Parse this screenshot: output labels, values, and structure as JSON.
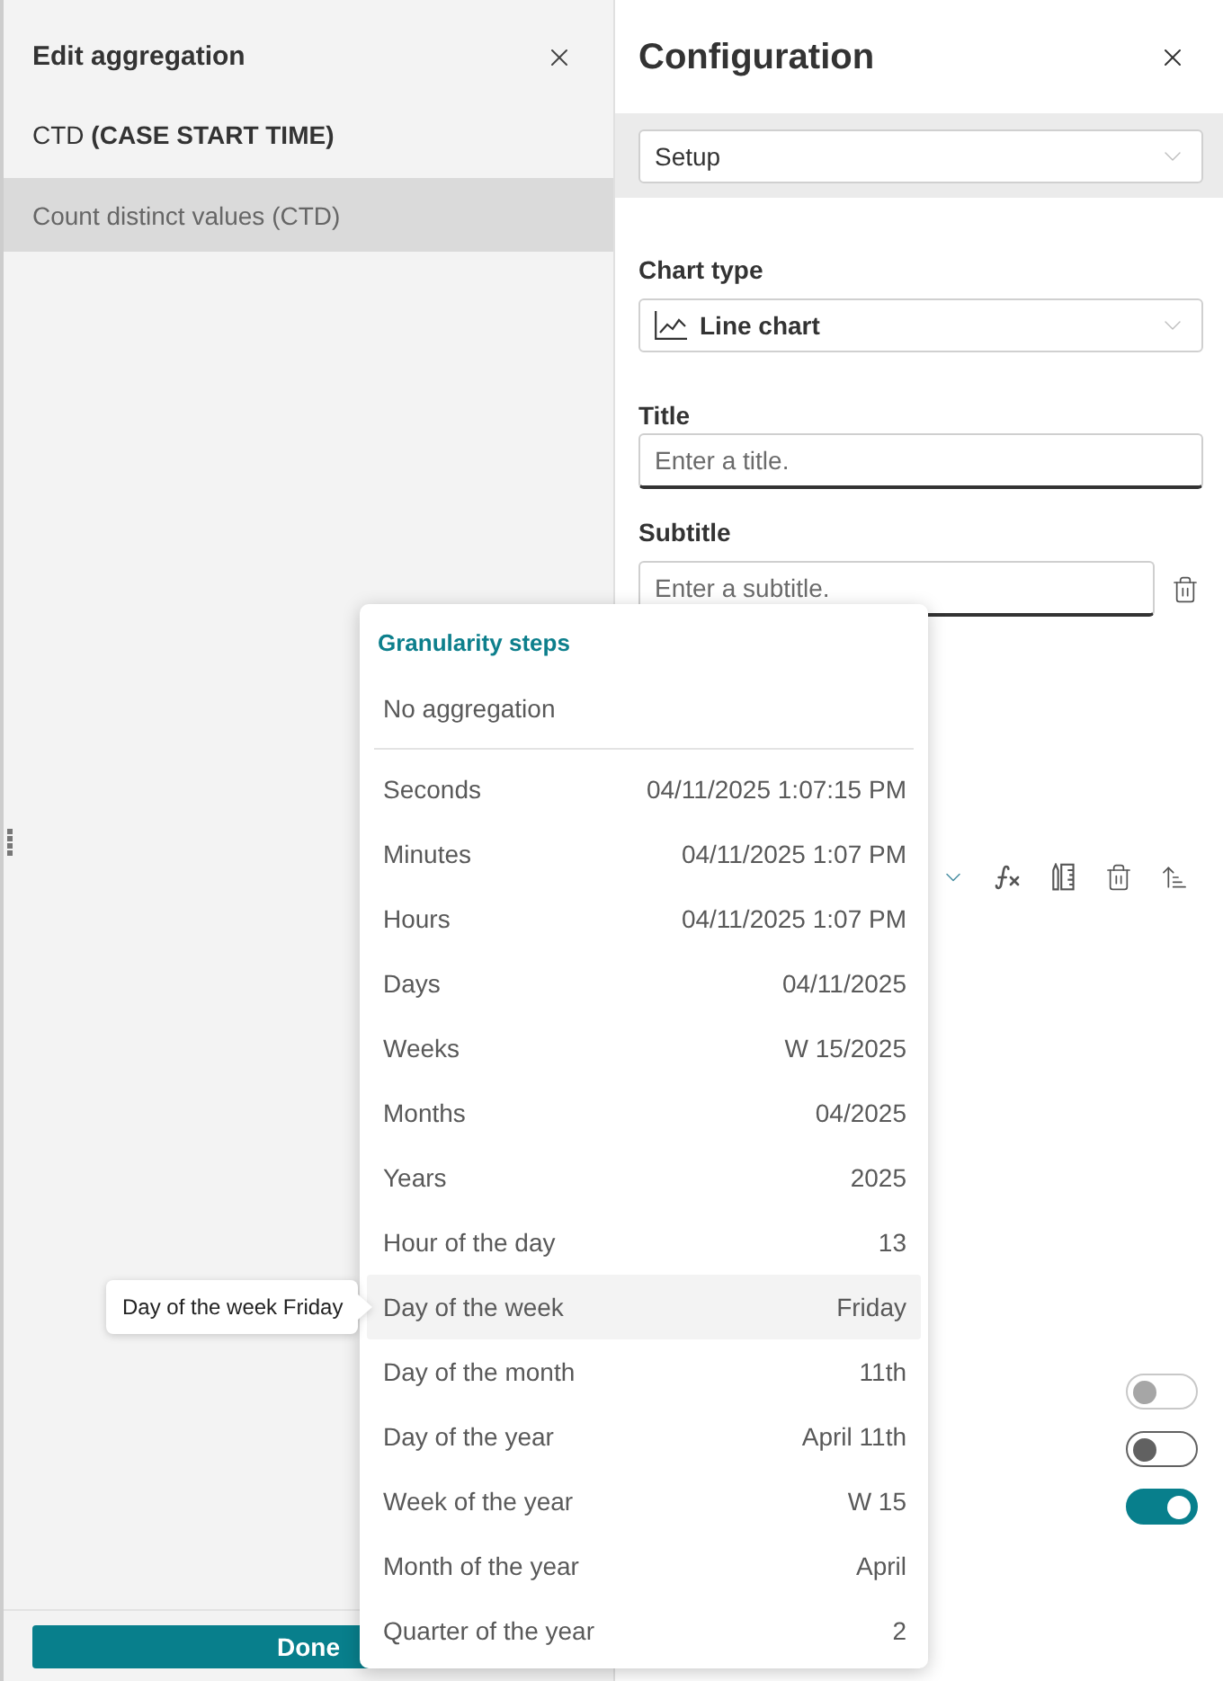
{
  "edit_panel": {
    "title": "Edit aggregation",
    "field": "CTD **(CASE START TIME)**",
    "aggregations": [
      {
        "label": "Count distinct values (CTD)",
        "selected": true
      }
    ],
    "done_button": "Done"
  },
  "configuration": {
    "title": "Configuration",
    "section_select": "Setup",
    "chart_type_label": "Chart type",
    "chart_type": "Line chart",
    "title_label": "Title",
    "title_placeholder": "Enter a title.",
    "subtitle_label": "Subtitle",
    "subtitle_placeholder": "Enter a subtitle.",
    "toggles": [
      {
        "on": false,
        "disabled": true
      },
      {
        "on": false,
        "disabled": false
      },
      {
        "on": true,
        "disabled": false
      }
    ]
  },
  "granularity_menu": {
    "heading": "Granularity steps",
    "no_aggregation": "No aggregation",
    "steps": [
      {
        "label": "Seconds",
        "example": "04/11/2025 1:07:15 PM",
        "highlighted": false
      },
      {
        "label": "Minutes",
        "example": "04/11/2025 1:07 PM",
        "highlighted": false
      },
      {
        "label": "Hours",
        "example": "04/11/2025 1:07 PM",
        "highlighted": false
      },
      {
        "label": "Days",
        "example": "04/11/2025",
        "highlighted": false
      },
      {
        "label": "Weeks",
        "example": "W 15/2025",
        "highlighted": false
      },
      {
        "label": "Months",
        "example": "04/2025",
        "highlighted": false
      },
      {
        "label": "Years",
        "example": "2025",
        "highlighted": false
      },
      {
        "label": "Hour of the day",
        "example": "13",
        "highlighted": false
      },
      {
        "label": "Day of the week",
        "example": "Friday",
        "highlighted": true
      },
      {
        "label": "Day of the month",
        "example": "11th",
        "highlighted": false
      },
      {
        "label": "Day of the year",
        "example": "April 11th",
        "highlighted": false
      },
      {
        "label": "Week of the year",
        "example": "W 15",
        "highlighted": false
      },
      {
        "label": "Month of the year",
        "example": "April",
        "highlighted": false
      },
      {
        "label": "Quarter of the year",
        "example": "2",
        "highlighted": false
      }
    ]
  },
  "tooltip": "Day of the week Friday"
}
